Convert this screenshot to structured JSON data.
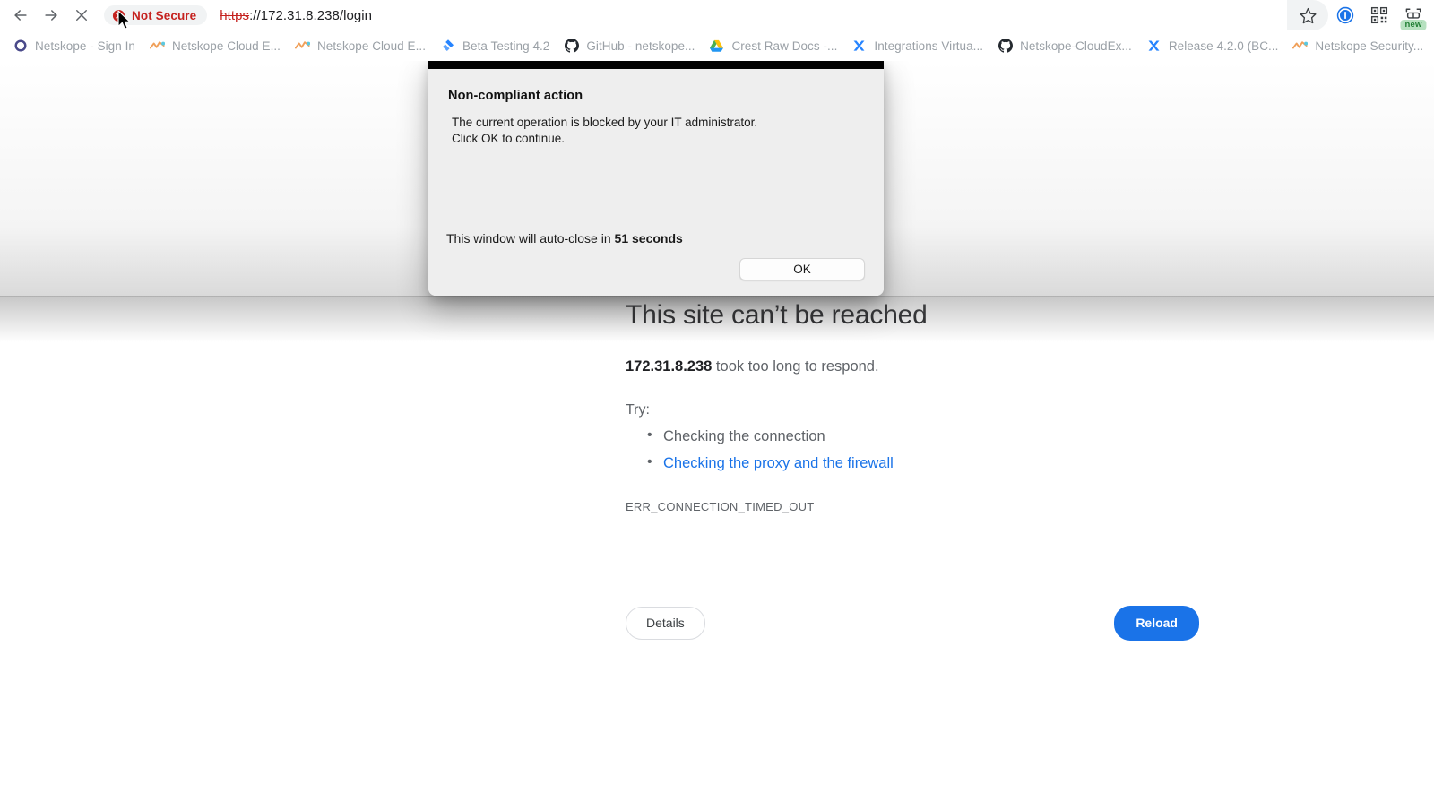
{
  "browser": {
    "nav": {
      "back_label": "Back",
      "forward_label": "Forward",
      "stop_label": "Stop"
    },
    "omnibox": {
      "security_label": "Not Secure",
      "security_icon": "not-secure-circle-icon",
      "url_scheme": "https",
      "url_rest": "://172.31.8.238/login",
      "full_url": "https://172.31.8.238/login"
    },
    "toolbar_right": [
      {
        "name": "bookmark-star-icon",
        "label": "Bookmark this tab"
      },
      {
        "name": "profile-icon",
        "label": "Profile"
      },
      {
        "name": "qr-code-icon",
        "label": "Create QR code"
      },
      {
        "name": "split-view-icon",
        "label": "Split view",
        "badge": "new"
      }
    ],
    "bookmarks": [
      {
        "label": "Netskope - Sign In",
        "icon": "netskope-ring-icon"
      },
      {
        "label": "Netskope Cloud E...",
        "icon": "netskope-wave-icon"
      },
      {
        "label": "Netskope Cloud E...",
        "icon": "netskope-wave-icon"
      },
      {
        "label": "Beta Testing 4.2",
        "icon": "jira-icon"
      },
      {
        "label": "GitHub - netskope...",
        "icon": "github-icon"
      },
      {
        "label": "Crest Raw Docs -...",
        "icon": "google-drive-icon"
      },
      {
        "label": "Integrations Virtua...",
        "icon": "jira-x-icon"
      },
      {
        "label": "Netskope-CloudEx...",
        "icon": "github-icon"
      },
      {
        "label": "Release 4.2.0 (BC...",
        "icon": "jira-x-icon"
      },
      {
        "label": "Netskope Security...",
        "icon": "netskope-wave-icon"
      }
    ]
  },
  "error_page": {
    "title": "This site can’t be reached",
    "summary_host": "172.31.8.238",
    "summary_rest": " took too long to respond.",
    "try_label": "Try:",
    "try_items": [
      {
        "text": "Checking the connection",
        "is_link": false
      },
      {
        "text": "Checking the proxy and the firewall",
        "is_link": true
      }
    ],
    "error_code": "ERR_CONNECTION_TIMED_OUT",
    "details_button": "Details",
    "reload_button": "Reload"
  },
  "dialog": {
    "heading": "Non-compliant action",
    "message_line1": "The current operation is blocked by your IT administrator.",
    "message_line2": "Click OK to continue.",
    "autoclose_prefix": "This window will auto-close in ",
    "autoclose_value": "51 seconds",
    "ok_button": "OK"
  },
  "colors": {
    "accent_blue": "#1a73e8",
    "danger_red": "#c5221f",
    "link_blue": "#1a73e8",
    "muted_text": "#5f6368",
    "bookmark_text": "#9aa0a6",
    "dialog_bg": "#eeeeee",
    "dialog_titlebar": "#000000",
    "badge_green_bg": "#b7e1c0"
  }
}
